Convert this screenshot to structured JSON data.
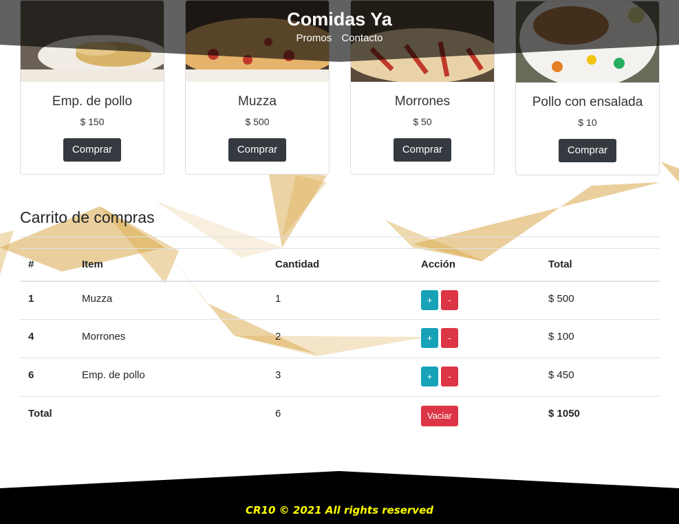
{
  "header": {
    "title": "Comidas Ya",
    "nav": [
      "Promos",
      "Contacto"
    ]
  },
  "products": [
    {
      "name": "Emp. de pollo",
      "price": "$ 150",
      "button": "Comprar"
    },
    {
      "name": "Muzza",
      "price": "$ 500",
      "button": "Comprar"
    },
    {
      "name": "Morrones",
      "price": "$ 50",
      "button": "Comprar"
    },
    {
      "name": "Pollo con ensalada",
      "price": "$ 10",
      "button": "Comprar"
    }
  ],
  "cart": {
    "title": "Carrito de compras",
    "columns": [
      "#",
      "Item",
      "Cantidad",
      "Acción",
      "Total"
    ],
    "rows": [
      {
        "id": "1",
        "item": "Muzza",
        "qty": "1",
        "plus": "+",
        "minus": "-",
        "total": "$ 500"
      },
      {
        "id": "4",
        "item": "Morrones",
        "qty": "2",
        "plus": "+",
        "minus": "-",
        "total": "$ 100"
      },
      {
        "id": "6",
        "item": "Emp. de pollo",
        "qty": "3",
        "plus": "+",
        "minus": "-",
        "total": "$ 450"
      }
    ],
    "summary": {
      "label": "Total",
      "qty": "6",
      "clear": "Vaciar",
      "total": "$ 1050"
    }
  },
  "footer": {
    "text": "CR10 © 2021 All rights reserved"
  },
  "colors": {
    "dark_button": "#343a40",
    "plus_button": "#17a2b8",
    "minus_button": "#dc3545",
    "footer_text": "#ffff00",
    "deco": "#d9a84a"
  }
}
